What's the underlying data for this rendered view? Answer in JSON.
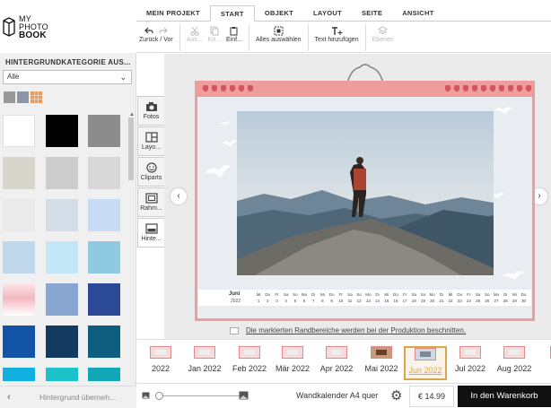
{
  "logo": {
    "line1": "MY",
    "line2": "PHOTO",
    "line3": "BOOK"
  },
  "tabs": [
    {
      "label": "MEIN PROJEKT"
    },
    {
      "label": "START",
      "active": true
    },
    {
      "label": "OBJEKT"
    },
    {
      "label": "LAYOUT"
    },
    {
      "label": "SEITE"
    },
    {
      "label": "ANSICHT"
    }
  ],
  "toolbar": {
    "undo_redo": "Zurück / Vor",
    "cut": "Aus...",
    "copy": "Ko...",
    "paste": "Einf...",
    "select_all": "Alles auswählen",
    "add_text": "Text hinzufügen",
    "layers": "Ebenen"
  },
  "left_panel": {
    "title": "HINTERGRUNDKATEGORIE AUS...",
    "category_value": "Alle",
    "apply_label": "Hintergrund überneh...",
    "swatches": [
      "#ffffff",
      "#000000",
      "#8c8c8c",
      "#d6d6cc",
      "#cccccc",
      "#d8d8d8",
      "#eaeaea",
      "#d3dde8",
      "#c8dcf5",
      "#c0d8ea",
      "#c2e8f8",
      "#8fcae0",
      "#f2b8bf",
      "#88a6d0",
      "#2c4a97",
      "#1454a6",
      "#153a60",
      "#0f5e80",
      "#12b0e0",
      "#1cc1c9",
      "#12a8b8"
    ]
  },
  "side_tools": [
    {
      "label": "Fotos",
      "icon": "camera-icon"
    },
    {
      "label": "Layo...",
      "icon": "layout-icon"
    },
    {
      "label": "Cliparts",
      "icon": "smiley-icon"
    },
    {
      "label": "Rahm...",
      "icon": "frame-icon"
    },
    {
      "label": "Hinte...",
      "icon": "background-icon",
      "active": true
    }
  ],
  "calendar": {
    "month": "Juni",
    "year": "2022",
    "days": [
      "Mi",
      "Do",
      "Fr",
      "Sa",
      "So",
      "Mo",
      "Di",
      "Mi",
      "Do",
      "Fr",
      "Sa",
      "So",
      "Mo",
      "Di",
      "Mi",
      "Do",
      "Fr",
      "Sa",
      "So",
      "Mo",
      "Di",
      "Mi",
      "Do",
      "Fr",
      "Sa",
      "So",
      "Mo",
      "Di",
      "Mi",
      "Do"
    ],
    "dates": [
      "1",
      "2",
      "3",
      "4",
      "5",
      "6",
      "7",
      "8",
      "9",
      "10",
      "11",
      "12",
      "13",
      "14",
      "15",
      "16",
      "17",
      "18",
      "19",
      "20",
      "21",
      "22",
      "23",
      "24",
      "25",
      "26",
      "27",
      "28",
      "29",
      "30"
    ],
    "accent_color": "#ee9c9c"
  },
  "cut_note": "Die markierten Randbereiche werden bei der Produktion beschnitten.",
  "months": [
    {
      "label": "2022"
    },
    {
      "label": "Jan 2022"
    },
    {
      "label": "Feb 2022"
    },
    {
      "label": "Mär 2022"
    },
    {
      "label": "Apr 2022"
    },
    {
      "label": "Mai 2022"
    },
    {
      "label": "Jun 2022",
      "active": true
    },
    {
      "label": "Jul 2022"
    },
    {
      "label": "Aug 2022"
    },
    {
      "label": "Se"
    }
  ],
  "bottom_bar": {
    "product": "Wandkalender A4 quer",
    "price": "€ 14.99",
    "cart": "In den Warenkorb"
  }
}
